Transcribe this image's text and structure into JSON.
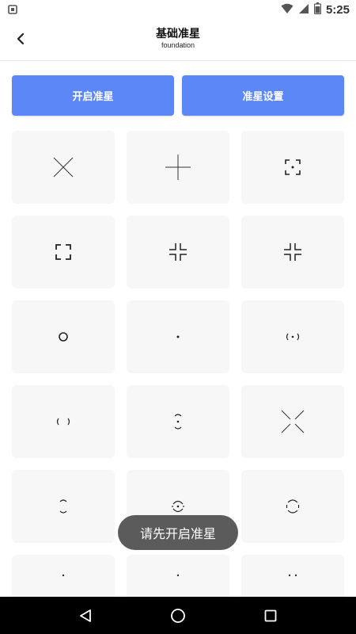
{
  "status_bar": {
    "time": "5:25",
    "left_icon": "notification-app-icon",
    "icons": [
      "wifi-icon",
      "cellular-signal-icon",
      "battery-icon"
    ]
  },
  "header": {
    "title": "基础准星",
    "subtitle": "foundation",
    "back_icon": "back-arrow-icon"
  },
  "actions": {
    "enable_label": "开启准星",
    "settings_label": "准星设置"
  },
  "crosshairs": [
    "x-cross",
    "plus-cross",
    "dot-bracket",
    "square-corners",
    "gap-cross",
    "gap-cross-small",
    "circle",
    "center-dot",
    "paren-dot",
    "paren-pair",
    "arc-dot",
    "large-x-gap",
    "arc-pair",
    "circle-dot",
    "circle-gap",
    "dot-top",
    "dot-small",
    "dot-pair"
  ],
  "toast": {
    "message": "请先开启准星"
  },
  "nav_bar": {
    "icons": [
      "back-triangle-icon",
      "home-circle-icon",
      "recents-square-icon"
    ]
  },
  "colors": {
    "accent": "#5b87f7",
    "cell_bg": "#f7f7f8",
    "toast_bg": "#5b5b5b",
    "nav_bg": "#000000"
  }
}
